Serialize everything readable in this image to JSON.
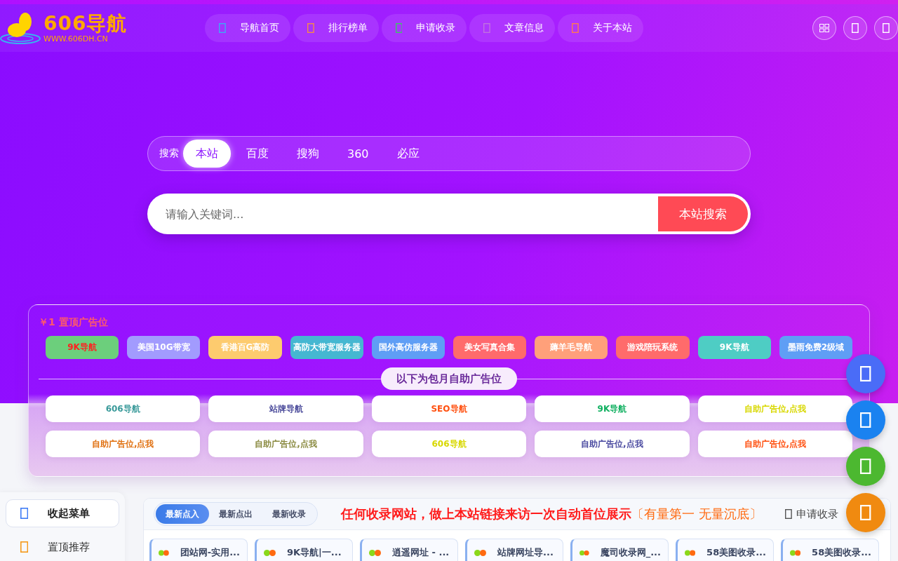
{
  "header": {
    "logo_title": "606导航",
    "logo_url": "WWW.606DH.CN",
    "nav": [
      {
        "label": "导航首页",
        "color": "#3fa9f5"
      },
      {
        "label": "排行榜单",
        "color": "#f5894a"
      },
      {
        "label": "申请收录",
        "color": "#3cc46a"
      },
      {
        "label": "文章信息",
        "color": "#c070e0"
      },
      {
        "label": "关于本站",
        "color": "#ff7a50"
      }
    ],
    "actions": [
      {
        "kind": "grid"
      },
      {
        "kind": "box"
      },
      {
        "kind": "box"
      }
    ]
  },
  "search": {
    "label": "搜索",
    "engines": [
      {
        "label": "本站",
        "selected": true
      },
      {
        "label": "百度",
        "selected": false
      },
      {
        "label": "搜狗",
        "selected": false
      },
      {
        "label": "360",
        "selected": false
      },
      {
        "label": "必应",
        "selected": false
      }
    ],
    "placeholder": "请输入关键词...",
    "button": "本站搜索"
  },
  "ads": {
    "title": "￥1 置顶广告位",
    "top": [
      {
        "label": "9K导航",
        "color": "#6ccf7c",
        "highlighted": true
      },
      {
        "label": "美国10G带宽",
        "color": "#a29bfe",
        "highlighted": false
      },
      {
        "label": "香港百G高防",
        "color": "#fdcb6e",
        "highlighted": false
      },
      {
        "label": "高防大带宽服务器",
        "color": "#45b7d1",
        "highlighted": false
      },
      {
        "label": "国外高仿服务器",
        "color": "#5f9ef5",
        "highlighted": false
      },
      {
        "label": "美女写真合集",
        "color": "#ff6b6b",
        "highlighted": false
      },
      {
        "label": "薅羊毛导航",
        "color": "#ffa07a",
        "highlighted": false
      },
      {
        "label": "游戏陪玩系统",
        "color": "#ff6b6b",
        "highlighted": false
      },
      {
        "label": "9K导航",
        "color": "#4ecdc4",
        "highlighted": false
      },
      {
        "label": "墨雨免费2级域",
        "color": "#5f9ef5",
        "highlighted": false
      }
    ],
    "divider_label": "以下为包月自助广告位",
    "monthly": [
      {
        "label": "606导航",
        "color": "#3a9a9a"
      },
      {
        "label": "站牌导航",
        "color": "#4a4a9a"
      },
      {
        "label": "SEO导航",
        "color": "#ff5010"
      },
      {
        "label": "9K导航",
        "color": "#10b060"
      },
      {
        "label": "自助广告位,点我",
        "color": "#d8d800"
      },
      {
        "label": "自助广告位,点我",
        "color": "#e07010"
      },
      {
        "label": "自助广告位,点我",
        "color": "#8a8a40"
      },
      {
        "label": "606导航",
        "color": "#d8d800"
      },
      {
        "label": "自助广告位,点我",
        "color": "#4a4aa0"
      },
      {
        "label": "自助广告位,点我",
        "color": "#ff5010"
      }
    ]
  },
  "sidebar": {
    "items": [
      {
        "label": "收起菜单",
        "selected": true,
        "color": "#3f7cf5"
      },
      {
        "label": "置顶推荐",
        "selected": false,
        "color": "#f59a1a"
      }
    ]
  },
  "main": {
    "tabs": [
      {
        "label": "最新点入",
        "selected": true
      },
      {
        "label": "最新点出",
        "selected": false
      },
      {
        "label": "最新收录",
        "selected": false
      }
    ],
    "notice": "任何收录网站，做上本站链接来访一次自动首位展示",
    "notice_emphasis": "〔有量第一 无量沉底〕",
    "apply_link": "申请收录",
    "sites": [
      "团站网-实用...",
      "9K导航|一...",
      "逍遥网址 - ...",
      "站牌网址导...",
      "魔司收录网_...",
      "58美图收录...",
      "58美图收录..."
    ]
  },
  "float_buttons": [
    {
      "color": "#4a6cf7"
    },
    {
      "color": "#1a82f0"
    },
    {
      "color": "#4cb830"
    },
    {
      "color": "#f08a10"
    }
  ]
}
